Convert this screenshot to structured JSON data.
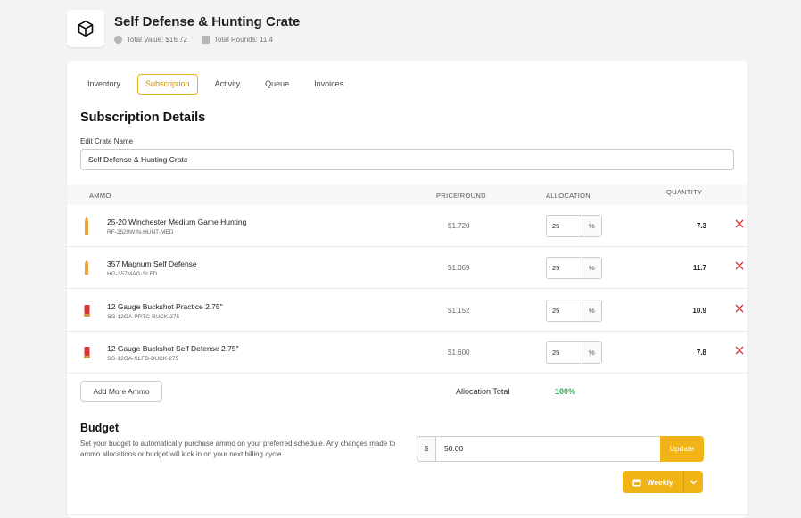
{
  "header": {
    "title": "Self Defense & Hunting Crate",
    "total_value": "Total Value: $16.72",
    "total_rounds": "Total Rounds: 11.4"
  },
  "tabs": [
    {
      "label": "Inventory",
      "active": false
    },
    {
      "label": "Subscription",
      "active": true
    },
    {
      "label": "Activity",
      "active": false
    },
    {
      "label": "Queue",
      "active": false
    },
    {
      "label": "Invoices",
      "active": false
    }
  ],
  "section": {
    "title": "Subscription Details",
    "crate_name_label": "Edit Crate Name",
    "crate_name_value": "Self Defense & Hunting Crate"
  },
  "table": {
    "headers": {
      "ammo": "AMMO",
      "price": "PRICE/ROUND",
      "allocation": "ALLOCATION",
      "quantity": "QUANTITY"
    },
    "rows": [
      {
        "name": "25-20 Winchester Medium Game Hunting",
        "sku": "RF-2520WIN-HUNT-MED",
        "price": "$1.720",
        "allocation": "25",
        "unit": "%",
        "quantity": "7.3",
        "bullet_color": "#f0a030"
      },
      {
        "name": "357 Magnum Self Defense",
        "sku": "HG-357MAG-SLFD",
        "price": "$1.069",
        "allocation": "25",
        "unit": "%",
        "quantity": "11.7",
        "bullet_color": "#f0a030"
      },
      {
        "name": "12 Gauge Buckshot Practice 2.75\"",
        "sku": "SG-12GA-PRTC-BUCK-275",
        "price": "$1.152",
        "allocation": "25",
        "unit": "%",
        "quantity": "10.9",
        "bullet_color": "#e03030"
      },
      {
        "name": "12 Gauge Buckshot Self Defense 2.75\"",
        "sku": "SG-12GA-SLFD-BUCK-275",
        "price": "$1.600",
        "allocation": "25",
        "unit": "%",
        "quantity": "7.8",
        "bullet_color": "#e03030"
      }
    ]
  },
  "add_more_label": "Add More Ammo",
  "allocation_total": {
    "label": "Allocation Total",
    "value": "100%"
  },
  "budget": {
    "title": "Budget",
    "description": "Set your budget to automatically purchase ammo on your preferred schedule. Any changes made to ammo allocations or budget will kick in on your next billing cycle.",
    "currency": "$",
    "amount": "50.00",
    "update_label": "Update",
    "frequency": "Weekly"
  },
  "colors": {
    "accent": "#f0b417",
    "success": "#3aa55a",
    "danger": "#d9302b"
  }
}
